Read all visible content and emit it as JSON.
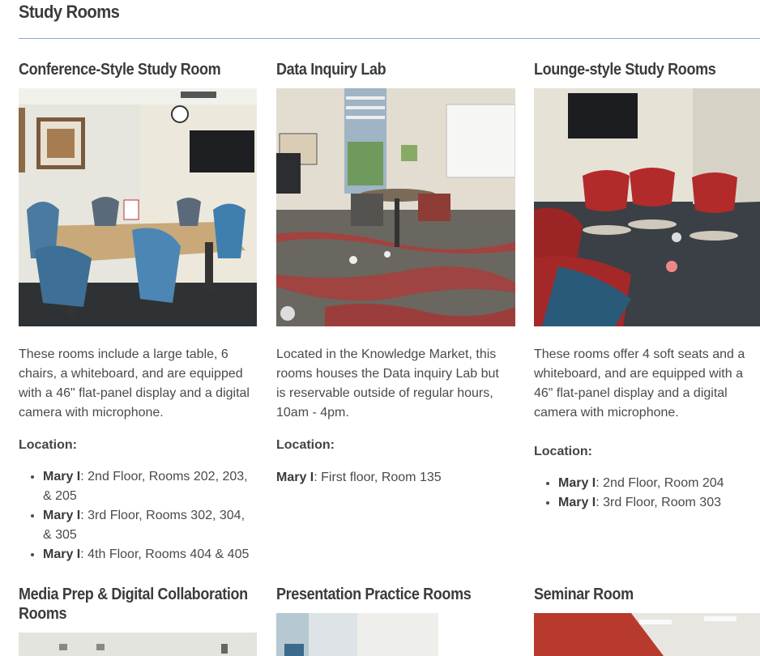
{
  "page": {
    "title": "Study Rooms"
  },
  "rooms": [
    {
      "title": "Conference-Style Study Room",
      "description": "These rooms include a large table, 6 chairs, a whiteboard, and are equipped with a 46\" flat-panel display and a digital camera with microphone.",
      "location_label": "Location:",
      "locations": [
        {
          "building": "Mary I",
          "detail": ": 2nd Floor, Rooms 202, 203, & 205"
        },
        {
          "building": "Mary I",
          "detail": ": 3rd Floor, Rooms 302, 304, & 305"
        },
        {
          "building": "Mary I",
          "detail": ": 4th Floor, Rooms 404 & 405"
        }
      ]
    },
    {
      "title": "Data Inquiry Lab",
      "description": "Located in the Knowledge Market, this rooms houses the Data inquiry Lab but is reservable outside of regular hours, 10am - 4pm.",
      "location_label": "Location:",
      "locations": [
        {
          "building": "Mary I",
          "detail": ": First floor, Room 135"
        }
      ]
    },
    {
      "title": "Lounge-style Study Rooms",
      "description": "These rooms offer 4 soft seats and a whiteboard, and are equipped with a 46\" flat-panel display and a digital camera with microphone.",
      "location_label": "Location:",
      "locations": [
        {
          "building": "Mary I",
          "detail": ": 2nd Floor, Room 204"
        },
        {
          "building": "Mary I",
          "detail": ": 3rd Floor, Room 303"
        }
      ]
    },
    {
      "title": "Media Prep & Digital Collaboration Rooms"
    },
    {
      "title": "Presentation Practice Rooms"
    },
    {
      "title": "Seminar Room"
    }
  ]
}
